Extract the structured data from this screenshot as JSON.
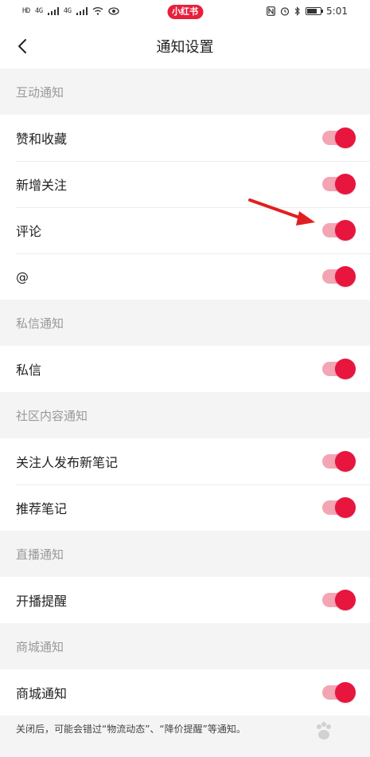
{
  "status_bar": {
    "left_indicators": [
      "HD",
      "4G",
      "4G"
    ],
    "app_badge": "小红书",
    "time": "5:01"
  },
  "nav": {
    "title": "通知设置",
    "back_icon": "chevron-left-icon"
  },
  "sections": [
    {
      "header": "互动通知",
      "items": [
        {
          "label": "赞和收藏",
          "enabled": true
        },
        {
          "label": "新增关注",
          "enabled": true
        },
        {
          "label": "评论",
          "enabled": true
        },
        {
          "label": "@",
          "enabled": true
        }
      ]
    },
    {
      "header": "私信通知",
      "items": [
        {
          "label": "私信",
          "enabled": true
        }
      ]
    },
    {
      "header": "社区内容通知",
      "items": [
        {
          "label": "关注人发布新笔记",
          "enabled": true
        },
        {
          "label": "推荐笔记",
          "enabled": true
        }
      ]
    },
    {
      "header": "直播通知",
      "items": [
        {
          "label": "开播提醒",
          "enabled": true
        }
      ]
    },
    {
      "header": "商城通知",
      "items": [
        {
          "label": "商城通知",
          "enabled": true
        }
      ]
    }
  ],
  "footer": {
    "note": "关闭后，可能会错过“物流动态”、“降价提醒”等通知。"
  },
  "colors": {
    "accent": "#e8153f",
    "toggle_track_on": "#f4a5b4",
    "annotation_arrow": "#e02020"
  }
}
